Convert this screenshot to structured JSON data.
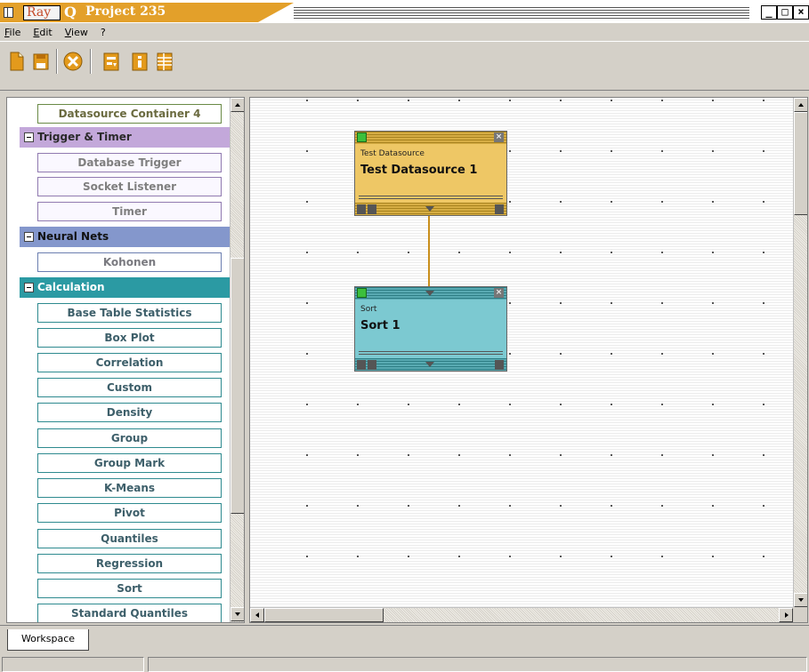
{
  "window": {
    "logo_text": "Ray",
    "logo_q": "Q",
    "title": "Project 235",
    "buttons": [
      "_",
      "□",
      "×"
    ]
  },
  "menu": [
    {
      "label": "File"
    },
    {
      "label": "Edit"
    },
    {
      "label": "View"
    },
    {
      "label": "?"
    }
  ],
  "toolbar": {
    "icons": [
      "new-document-icon",
      "save-icon",
      "delete-icon",
      "export-icon",
      "info-icon",
      "table-icon"
    ]
  },
  "palette": {
    "datasource_container": "Datasource Container 4",
    "trigger_header": "Trigger & Timer",
    "trigger_items": [
      "Database Trigger",
      "Socket Listener",
      "Timer"
    ],
    "neural_header": "Neural Nets",
    "neural_items": [
      "Kohonen"
    ],
    "calc_header": "Calculation",
    "calc_items": [
      "Base Table Statistics",
      "Box Plot",
      "Correlation",
      "Custom",
      "Density",
      "Group",
      "Group Mark",
      "K-Means",
      "Pivot",
      "Quantiles",
      "Regression",
      "Sort",
      "Standard Quantiles"
    ]
  },
  "nodes": [
    {
      "type": "Test Datasource",
      "name": "Test Datasource 1",
      "color": "#eec765"
    },
    {
      "type": "Sort",
      "name": "Sort 1",
      "color": "#7cc9d1"
    }
  ],
  "tabs": [
    {
      "label": "Workspace"
    }
  ],
  "colors": {
    "title_accent": "#e3a02a",
    "trigger": "#c3a8da",
    "neural": "#8497cc",
    "calculation": "#2b9aa3"
  }
}
